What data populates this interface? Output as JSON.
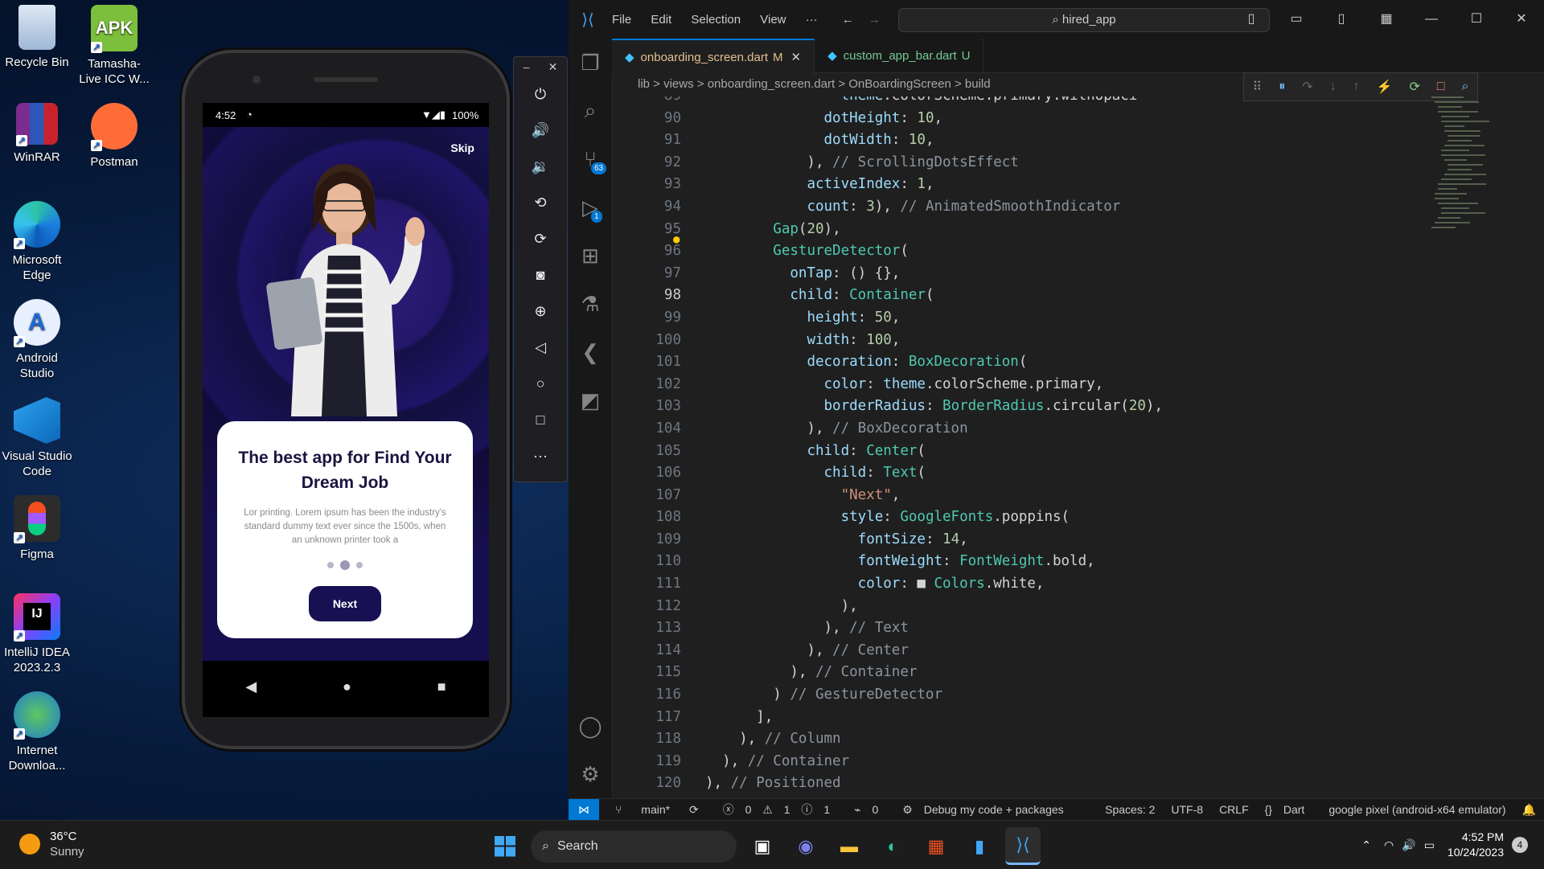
{
  "desktop": {
    "icons": [
      {
        "label": "Recycle Bin"
      },
      {
        "label": "Tamasha-Live ICC W..."
      },
      {
        "label": "WinRAR"
      },
      {
        "label": "Postman"
      },
      {
        "label": "Microsoft Edge"
      },
      {
        "label": "Android Studio"
      },
      {
        "label": "Visual Studio Code"
      },
      {
        "label": "Figma"
      },
      {
        "label": "IntelliJ IDEA 2023.2.3"
      },
      {
        "label": "Internet Downloa..."
      }
    ]
  },
  "phone": {
    "status_time": "4:52",
    "battery": "100%",
    "skip_label": "Skip",
    "card_title": "The best app for Find Your Dream Job",
    "card_body": "Lor printing. Lorem ipsum has been the industry's standard dummy text ever since the 1500s, when an unknown printer took a",
    "next_label": "Next",
    "page_count": 3,
    "active_page": 1
  },
  "vscode": {
    "menu": [
      "File",
      "Edit",
      "Selection",
      "View",
      "···"
    ],
    "search_text": "hired_app",
    "tabs": [
      {
        "label": "onboarding_screen.dart",
        "status": "M"
      },
      {
        "label": "custom_app_bar.dart",
        "status": "U"
      }
    ],
    "breadcrumbs": "lib > views > onboarding_screen.dart > OnBoardingScreen > build",
    "current_line": "98",
    "lines": [
      {
        "num": "89",
        "code": "                theme.colorScheme.primary.withOpaci"
      },
      {
        "num": "90",
        "code": "              dotHeight: 10,"
      },
      {
        "num": "91",
        "code": "              dotWidth: 10,"
      },
      {
        "num": "92",
        "code": "            ), // ScrollingDotsEffect"
      },
      {
        "num": "93",
        "code": "            activeIndex: 1,"
      },
      {
        "num": "94",
        "code": "            count: 3), // AnimatedSmoothIndicator"
      },
      {
        "num": "95",
        "code": "        Gap(20),"
      },
      {
        "num": "96",
        "code": "        GestureDetector("
      },
      {
        "num": "97",
        "code": "          onTap: () {},"
      },
      {
        "num": "98",
        "code": "          child: Container("
      },
      {
        "num": "99",
        "code": "            height: 50,"
      },
      {
        "num": "100",
        "code": "            width: 100,"
      },
      {
        "num": "101",
        "code": "            decoration: BoxDecoration("
      },
      {
        "num": "102",
        "code": "              color: theme.colorScheme.primary,"
      },
      {
        "num": "103",
        "code": "              borderRadius: BorderRadius.circular(20),"
      },
      {
        "num": "104",
        "code": "            ), // BoxDecoration"
      },
      {
        "num": "105",
        "code": "            child: Center("
      },
      {
        "num": "106",
        "code": "              child: Text("
      },
      {
        "num": "107",
        "code": "                \"Next\","
      },
      {
        "num": "108",
        "code": "                style: GoogleFonts.poppins("
      },
      {
        "num": "109",
        "code": "                  fontSize: 14,"
      },
      {
        "num": "110",
        "code": "                  fontWeight: FontWeight.bold,"
      },
      {
        "num": "111",
        "code": "                  color: ■ Colors.white,"
      },
      {
        "num": "112",
        "code": "                ),"
      },
      {
        "num": "113",
        "code": "              ), // Text"
      },
      {
        "num": "114",
        "code": "            ), // Center"
      },
      {
        "num": "115",
        "code": "          ), // Container"
      },
      {
        "num": "116",
        "code": "        ) // GestureDetector"
      },
      {
        "num": "117",
        "code": "      ],"
      },
      {
        "num": "118",
        "code": "    ), // Column"
      },
      {
        "num": "119",
        "code": "  ), // Container"
      },
      {
        "num": "120",
        "code": "), // Positioned"
      }
    ],
    "status": {
      "branch": "main*",
      "errors": "0",
      "warnings": "1",
      "info": "1",
      "ports": "0",
      "debug": "Debug my code + packages",
      "spaces": "Spaces: 2",
      "encoding": "UTF-8",
      "eol": "CRLF",
      "language": "Dart",
      "device": "google pixel (android-x64 emulator)"
    },
    "scm_badge": "63",
    "debug_badge": "1"
  },
  "taskbar": {
    "temp": "36°C",
    "condition": "Sunny",
    "search": "Search",
    "time": "4:52 PM",
    "date": "10/24/2023",
    "notifications": "4"
  }
}
